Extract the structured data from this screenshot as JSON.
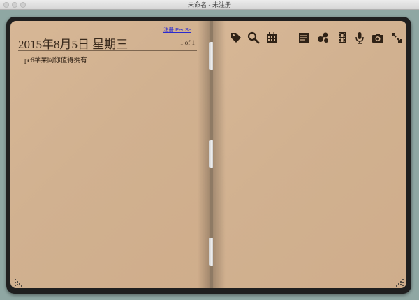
{
  "window": {
    "title": "未命名 - 未注册"
  },
  "register_link": "注册 Per Se",
  "entry": {
    "date_title": "2015年8月5日 星期三",
    "pager": "1 of 1",
    "text": "pc6苹果网你值得拥有"
  },
  "toolbar": {
    "icons": [
      "tag-icon",
      "search-icon",
      "calendar-icon",
      "notes-icon",
      "share-icon",
      "film-icon",
      "microphone-icon",
      "camera-icon",
      "expand-icon"
    ]
  },
  "colors": {
    "background": "#8fa7a3",
    "cover": "#1f1f1f",
    "paper": "#d4b493",
    "ink": "#3a2a1c",
    "link": "#2a2ad0"
  }
}
